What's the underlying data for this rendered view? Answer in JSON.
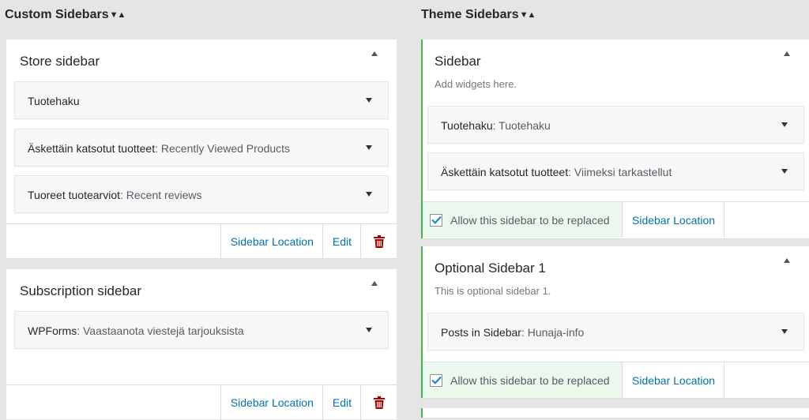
{
  "left_column": {
    "title": "Custom Sidebars",
    "sort_glyph": "▼▲",
    "sidebars": [
      {
        "title": "Store sidebar",
        "widgets": [
          {
            "name": "Tuotehaku",
            "title": ""
          },
          {
            "name": "Äskettäin katsotut tuotteet",
            "title": ": Recently Viewed Products"
          },
          {
            "name": "Tuoreet tuotearviot",
            "title": ": Recent reviews"
          }
        ],
        "links": {
          "location": "Sidebar Location",
          "edit": "Edit"
        }
      },
      {
        "title": "Subscription sidebar",
        "widgets": [
          {
            "name": "WPForms",
            "title": ": Vaastaanota viestejä tarjouksista"
          }
        ],
        "links": {
          "location": "Sidebar Location",
          "edit": "Edit"
        }
      }
    ]
  },
  "right_column": {
    "title": "Theme Sidebars",
    "sort_glyph": "▼▲",
    "sidebars": [
      {
        "title": "Sidebar",
        "description": "Add widgets here.",
        "widgets": [
          {
            "name": "Tuotehaku",
            "title": ": Tuotehaku"
          },
          {
            "name": "Äskettäin katsotut tuotteet",
            "title": ": Viimeksi tarkastellut"
          }
        ],
        "replace_label": "Allow this sidebar to be replaced",
        "replace_checked": true,
        "location_link": "Sidebar Location"
      },
      {
        "title": "Optional Sidebar 1",
        "description": "This is optional sidebar 1.",
        "widgets": [
          {
            "name": "Posts in Sidebar",
            "title": ": Hunaja-info"
          }
        ],
        "replace_label": "Allow this sidebar to be replaced",
        "replace_checked": true,
        "location_link": "Sidebar Location"
      }
    ]
  },
  "colors": {
    "link": "#0073aa",
    "delete": "#a00",
    "theme_border": "#46b450",
    "replace_bg": "#ecf7ed",
    "checkmark": "#1e8cbe"
  },
  "icons": {
    "collapse": "triangle-up-icon",
    "widget_toggle": "triangle-down-icon",
    "delete": "trash-icon",
    "checkbox": "checkmark-icon"
  }
}
